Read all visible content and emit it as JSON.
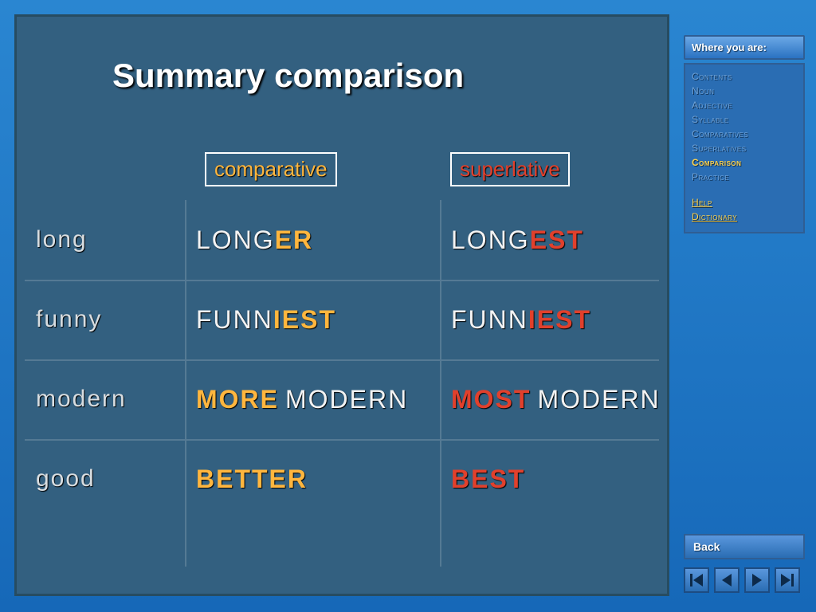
{
  "title": "Summary comparison",
  "headers": {
    "comparative": "comparative",
    "superlative": "superlative"
  },
  "rows": [
    {
      "base": "long",
      "comp_stem": "long",
      "comp_suf": "er",
      "sup_stem": "long",
      "sup_suf": "est"
    },
    {
      "base": "funny",
      "comp_stem": "funn",
      "comp_suf": "iest",
      "sup_stem": "funn",
      "sup_suf": "iest"
    },
    {
      "base": "modern",
      "comp_pre": "more",
      "comp_stem": "modern",
      "sup_pre": "most",
      "sup_stem": "modern"
    },
    {
      "base": "good",
      "comp_full": "better",
      "sup_full": "best"
    }
  ],
  "sidebar": {
    "header": "Where you are:",
    "items": [
      {
        "label": "Contents",
        "state": "dim"
      },
      {
        "label": "Noun",
        "state": "dim"
      },
      {
        "label": "Adjective",
        "state": "dim"
      },
      {
        "label": "Syllable",
        "state": "dim"
      },
      {
        "label": "Comparatives",
        "state": "dim"
      },
      {
        "label": "Superlatives",
        "state": "dim"
      },
      {
        "label": "Comparison",
        "state": "active"
      },
      {
        "label": "Practice",
        "state": "dim"
      }
    ],
    "links": [
      {
        "label": "Help"
      },
      {
        "label": "Dictionary"
      }
    ]
  },
  "back_label": "Back"
}
